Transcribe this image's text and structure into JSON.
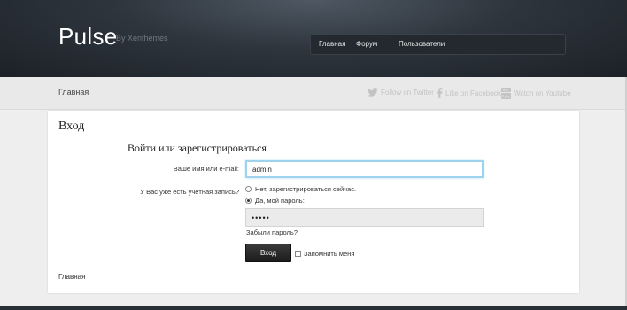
{
  "header": {
    "logo": "Pulse",
    "byline": "By Xenthemes",
    "nav": [
      {
        "label": "Главная"
      },
      {
        "label": "Форум"
      },
      {
        "label": "Пользователи"
      }
    ]
  },
  "breadcrumb": {
    "home": "Главная",
    "social": [
      {
        "label": "Follow on Twitter",
        "icon": "twitter-icon"
      },
      {
        "label": "Like on Facebook",
        "icon": "facebook-icon"
      },
      {
        "label": "Watch on Youtube",
        "icon": "youtube-icon"
      }
    ]
  },
  "login": {
    "title": "Вход",
    "subtitle": "Войти или зарегистрироваться",
    "username_label": "Ваше имя или e-mail:",
    "username_value": "admin",
    "account_question": "У Вас уже есть учётная запись?",
    "option_no": "Нет, зарегистрироваться сейчас.",
    "option_yes": "Да, мой пароль:",
    "selected_option": "yes",
    "password_value": "•••••",
    "forgot_link": "Забыли пароль?",
    "submit_label": "Вход",
    "remember_label": "Запомнить меня",
    "remember_checked": false
  },
  "footer": {
    "breadcrumb": "Главная"
  }
}
